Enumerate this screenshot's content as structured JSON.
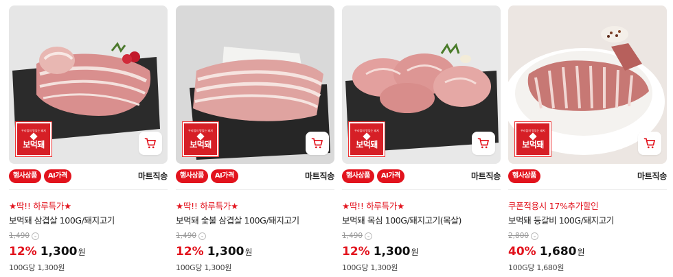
{
  "products": [
    {
      "name": "보먹돼 삼겹살 100G/돼지고기",
      "promo": "★딱!! 하루특가★",
      "tags": [
        "행사상품",
        "AI가격"
      ],
      "delivery": "마트직송",
      "original_price": "1,490",
      "discount": "12%",
      "price": "1,300",
      "currency": "원",
      "unit_price": "100G당 1,300원",
      "brand_small": "우리집의 맛있는 돼지",
      "brand_big": "보먹돼",
      "image": "pork-belly-on-slate"
    },
    {
      "name": "보먹돼 숯불 삼겹살 100G/돼지고기",
      "promo": "★딱!! 하루특가★",
      "tags": [
        "행사상품",
        "AI가격"
      ],
      "delivery": "마트직송",
      "original_price": "1,490",
      "discount": "12%",
      "price": "1,300",
      "currency": "원",
      "unit_price": "100G당 1,300원",
      "brand_small": "우리집의 맛있는 돼지",
      "brand_big": "보먹돼",
      "image": "sliced-pork-belly-on-slate"
    },
    {
      "name": "보먹돼 목심 100G/돼지고기(목살)",
      "promo": "★딱!! 하루특가★",
      "tags": [
        "행사상품",
        "AI가격"
      ],
      "delivery": "마트직송",
      "original_price": "1,490",
      "discount": "12%",
      "price": "1,300",
      "currency": "원",
      "unit_price": "100G당 1,300원",
      "brand_small": "우리집의 맛있는 돼지",
      "brand_big": "보먹돼",
      "image": "pork-neck-on-slate"
    },
    {
      "name": "보먹돼 등갈비 100G/돼지고기",
      "promo": "쿠폰적용시 17%추가할인",
      "tags": [
        "행사상품"
      ],
      "delivery": "마트직송",
      "original_price": "2,800",
      "discount": "40%",
      "price": "1,680",
      "currency": "원",
      "unit_price": "100G당 1,680원",
      "brand_small": "우리집의 맛있는 돼지",
      "brand_big": "보먹돼",
      "image": "pork-ribs-in-bowl"
    }
  ],
  "colors": {
    "accent": "#e2131d",
    "text": "#222222",
    "muted": "#999999",
    "photo_bg": "#e9e9e9"
  },
  "icons": {
    "cart": "cart-icon",
    "info": "info-icon"
  }
}
